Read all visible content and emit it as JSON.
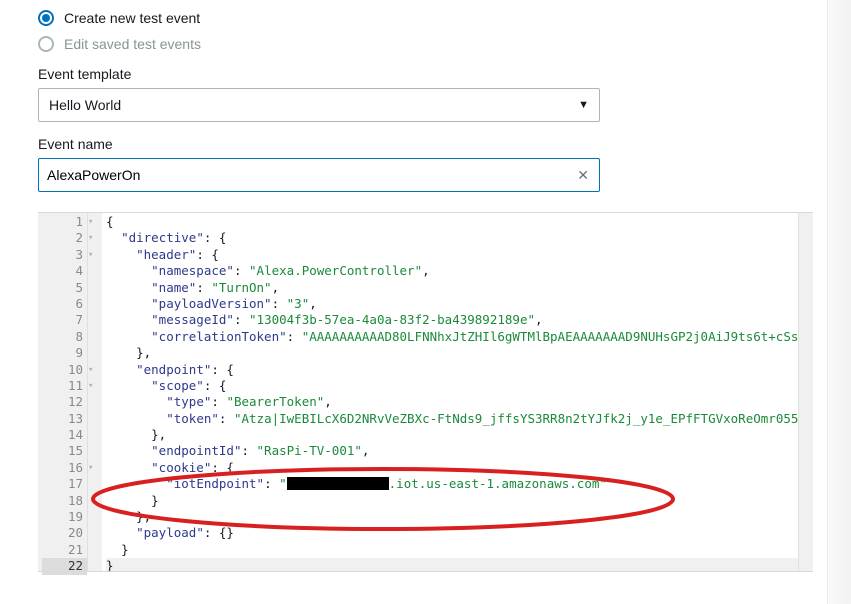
{
  "radios": {
    "create": "Create new test event",
    "edit": "Edit saved test events"
  },
  "labels": {
    "template": "Event template",
    "name": "Event name"
  },
  "template": {
    "selected": "Hello World"
  },
  "eventName": {
    "value": "AlexaPowerOn"
  },
  "editor": {
    "lines": [
      {
        "n": 1,
        "fold": "▾",
        "indent": 0,
        "parts": [
          {
            "p": "{"
          }
        ]
      },
      {
        "n": 2,
        "fold": "▾",
        "indent": 1,
        "parts": [
          {
            "k": "\"directive\""
          },
          {
            "p": ": {"
          }
        ]
      },
      {
        "n": 3,
        "fold": "▾",
        "indent": 2,
        "parts": [
          {
            "k": "\"header\""
          },
          {
            "p": ": {"
          }
        ]
      },
      {
        "n": 4,
        "fold": "",
        "indent": 3,
        "parts": [
          {
            "k": "\"namespace\""
          },
          {
            "p": ": "
          },
          {
            "s": "\"Alexa.PowerController\""
          },
          {
            "p": ","
          }
        ]
      },
      {
        "n": 5,
        "fold": "",
        "indent": 3,
        "parts": [
          {
            "k": "\"name\""
          },
          {
            "p": ": "
          },
          {
            "s": "\"TurnOn\""
          },
          {
            "p": ","
          }
        ]
      },
      {
        "n": 6,
        "fold": "",
        "indent": 3,
        "parts": [
          {
            "k": "\"payloadVersion\""
          },
          {
            "p": ": "
          },
          {
            "s": "\"3\""
          },
          {
            "p": ","
          }
        ]
      },
      {
        "n": 7,
        "fold": "",
        "indent": 3,
        "parts": [
          {
            "k": "\"messageId\""
          },
          {
            "p": ": "
          },
          {
            "s": "\"13004f3b-57ea-4a0a-83f2-ba439892189e\""
          },
          {
            "p": ","
          }
        ]
      },
      {
        "n": 8,
        "fold": "",
        "indent": 3,
        "parts": [
          {
            "k": "\"correlationToken\""
          },
          {
            "p": ": "
          },
          {
            "s": "\"AAAAAAAAAAD80LFNNhxJtZHIl6gWTMlBpAEAAAAAAAD9NUHsGP2j0AiJ9ts6t+cSs"
          }
        ]
      },
      {
        "n": 9,
        "fold": "",
        "indent": 2,
        "parts": [
          {
            "p": "},"
          }
        ]
      },
      {
        "n": 10,
        "fold": "▾",
        "indent": 2,
        "parts": [
          {
            "k": "\"endpoint\""
          },
          {
            "p": ": {"
          }
        ]
      },
      {
        "n": 11,
        "fold": "▾",
        "indent": 3,
        "parts": [
          {
            "k": "\"scope\""
          },
          {
            "p": ": {"
          }
        ]
      },
      {
        "n": 12,
        "fold": "",
        "indent": 4,
        "parts": [
          {
            "k": "\"type\""
          },
          {
            "p": ": "
          },
          {
            "s": "\"BearerToken\""
          },
          {
            "p": ","
          }
        ]
      },
      {
        "n": 13,
        "fold": "",
        "indent": 4,
        "parts": [
          {
            "k": "\"token\""
          },
          {
            "p": ": "
          },
          {
            "s": "\"Atza|IwEBILcX6D2NRvVeZBXc-FtNds9_jffsYS3RR8n2tYJfk2j_y1e_EPfFTGVxoReOmr055"
          }
        ]
      },
      {
        "n": 14,
        "fold": "",
        "indent": 3,
        "parts": [
          {
            "p": "},"
          }
        ]
      },
      {
        "n": 15,
        "fold": "",
        "indent": 3,
        "parts": [
          {
            "k": "\"endpointId\""
          },
          {
            "p": ": "
          },
          {
            "s": "\"RasPi-TV-001\""
          },
          {
            "p": ","
          }
        ]
      },
      {
        "n": 16,
        "fold": "▾",
        "indent": 3,
        "parts": [
          {
            "k": "\"cookie\""
          },
          {
            "p": ": {"
          }
        ]
      },
      {
        "n": 17,
        "fold": "",
        "indent": 4,
        "parts": [
          {
            "k": "\"iotEndpoint\""
          },
          {
            "p": ": "
          },
          {
            "s": "\""
          },
          {
            "redact": true
          },
          {
            "s": ".iot.us-east-1.amazonaws.com\""
          }
        ]
      },
      {
        "n": 18,
        "fold": "",
        "indent": 3,
        "parts": [
          {
            "p": "}"
          }
        ]
      },
      {
        "n": 19,
        "fold": "",
        "indent": 2,
        "parts": [
          {
            "p": "},"
          }
        ]
      },
      {
        "n": 20,
        "fold": "",
        "indent": 2,
        "parts": [
          {
            "k": "\"payload\""
          },
          {
            "p": ": {}"
          }
        ]
      },
      {
        "n": 21,
        "fold": "",
        "indent": 1,
        "parts": [
          {
            "p": "}"
          }
        ]
      },
      {
        "n": 22,
        "fold": "",
        "indent": 0,
        "parts": [
          {
            "p": "}"
          }
        ],
        "current": true
      }
    ]
  }
}
